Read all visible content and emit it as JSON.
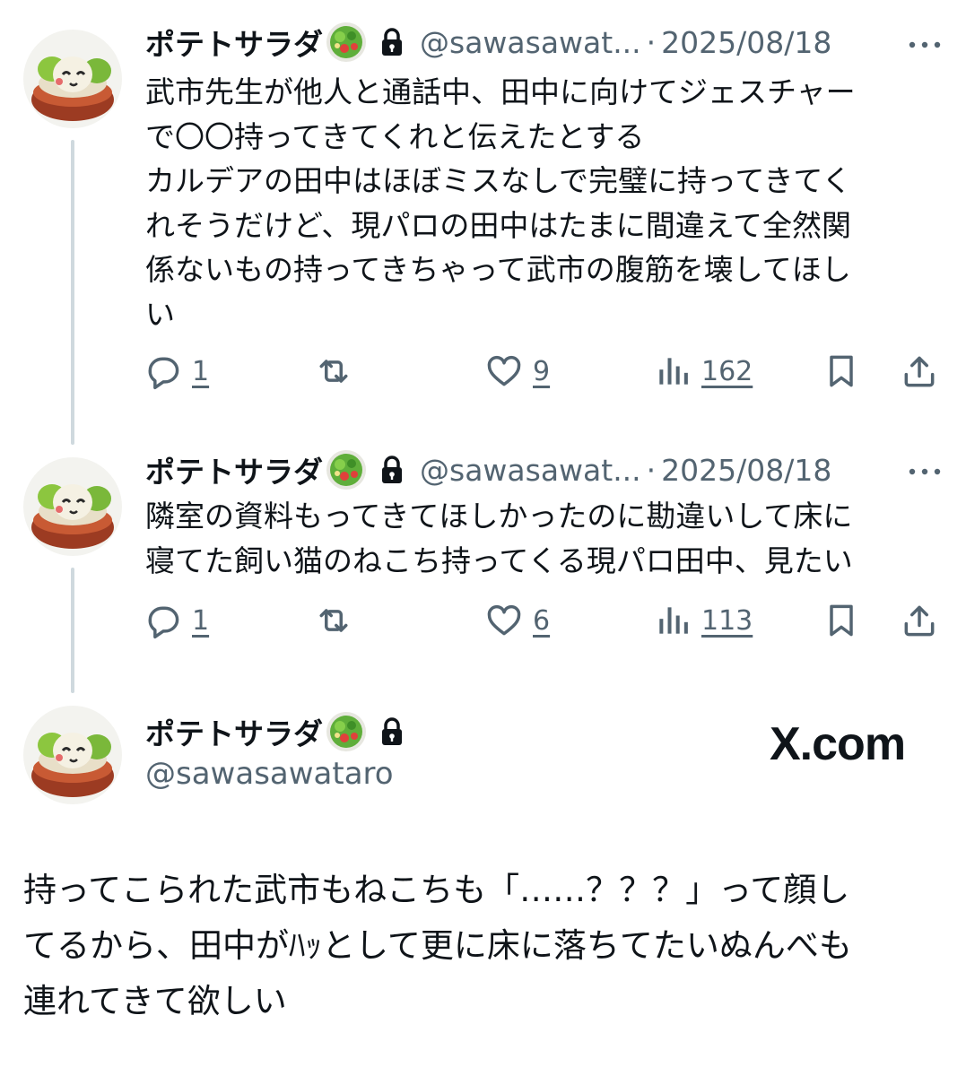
{
  "tweets": [
    {
      "name": "ポテトサラダ",
      "handle": "@sawasawat...",
      "separator": "·",
      "date": "2025/08/18",
      "body": "武市先生が他人と通話中、田中に向けてジェスチャーで〇〇持ってきてくれと伝えたとする\nカルデアの田中はほぼミスなしで完璧に持ってきてくれそうだけど、現パロの田中はたまに間違えて全然関係ないもの持ってきちゃって武市の腹筋を壊してほしい",
      "replies": "1",
      "likes": "9",
      "views": "162"
    },
    {
      "name": "ポテトサラダ",
      "handle": "@sawasawat...",
      "separator": "·",
      "date": "2025/08/18",
      "body": "隣室の資料もってきてほしかったのに勘違いして床に寝てた飼い猫のねこち持ってくる現パロ田中、見たい",
      "replies": "1",
      "likes": "6",
      "views": "113"
    }
  ],
  "main_tweet": {
    "name": "ポテトサラダ",
    "handle": "@sawasawataro",
    "brand": "X.com",
    "body": "持ってこられた武市もねこちも「……？？？」って顔してるから、田中がﾊｯとして更に床に落ちてたいぬんべも連れてきて欲しい"
  },
  "icons": [
    "avatar",
    "salad-emoji",
    "lock-icon",
    "more-icon",
    "reply-icon",
    "retweet-icon",
    "like-icon",
    "views-icon",
    "bookmark-icon",
    "share-icon"
  ],
  "colors": {
    "text": "#0f1419",
    "secondary": "#536471",
    "thread_line": "#cfd9de"
  }
}
